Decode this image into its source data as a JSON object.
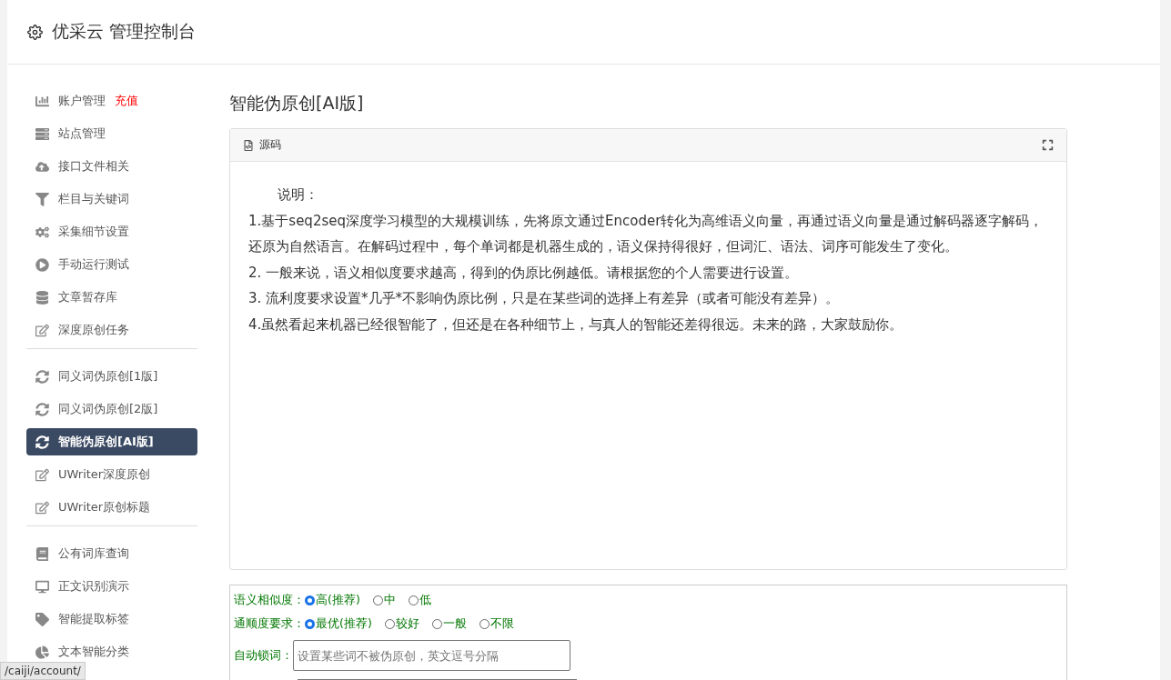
{
  "header": {
    "title": "优采云 管理控制台"
  },
  "sidebar": {
    "groups": [
      {
        "items": [
          {
            "label": "账户管理",
            "badge": "充值",
            "selected": false
          },
          {
            "label": "站点管理",
            "selected": false
          },
          {
            "label": "接口文件相关",
            "selected": false
          },
          {
            "label": "栏目与关键词",
            "selected": false
          },
          {
            "label": "采集细节设置",
            "selected": false
          },
          {
            "label": "手动运行测试",
            "selected": false
          },
          {
            "label": "文章暂存库",
            "selected": false
          },
          {
            "label": "深度原创任务",
            "selected": false
          }
        ]
      },
      {
        "items": [
          {
            "label": "同义词伪原创[1版]",
            "selected": false
          },
          {
            "label": "同义词伪原创[2版]",
            "selected": false
          },
          {
            "label": "智能伪原创[AI版]",
            "selected": true
          },
          {
            "label": "UWriter深度原创",
            "selected": false
          },
          {
            "label": "UWriter原创标题",
            "selected": false
          }
        ]
      },
      {
        "items": [
          {
            "label": "公有词库查询",
            "selected": false
          },
          {
            "label": "正文识别演示",
            "selected": false
          },
          {
            "label": "智能提取标签",
            "selected": false
          },
          {
            "label": "文本智能分类",
            "selected": false
          }
        ]
      }
    ]
  },
  "main": {
    "title": "智能伪原创[AI版]",
    "editor": {
      "toolbar_label": "源码",
      "paragraphs": [
        "说明：",
        "1.基于seq2seq深度学习模型的大规模训练，先将原文通过Encoder转化为高维语义向量，再通过语义向量是通过解码器逐字解码，还原为自然语言。在解码过程中，每个单词都是机器生成的，语义保持得很好，但词汇、语法、词序可能发生了变化。",
        "2. 一般来说，语义相似度要求越高，得到的伪原比例越低。请根据您的个人需要进行设置。",
        "3. 流利度要求设置*几乎*不影响伪原比例，只是在某些词的选择上有差异（或者可能没有差异）。",
        "4.虽然看起来机器已经很智能了，但还是在各种细节上，与真人的智能还差得很远。未来的路，大家鼓励你。"
      ]
    },
    "options": [
      {
        "label": "语义相似度：",
        "choices": [
          {
            "label": "高(推荐)",
            "selected": true
          },
          {
            "label": "中",
            "selected": false
          },
          {
            "label": "低",
            "selected": false
          }
        ]
      },
      {
        "label": "通顺度要求：",
        "choices": [
          {
            "label": "最优(推荐)",
            "selected": true
          },
          {
            "label": "较好",
            "selected": false
          },
          {
            "label": "一般",
            "selected": false
          },
          {
            "label": "不限",
            "selected": false
          }
        ]
      }
    ],
    "lock_words": {
      "label": "自动锁词：",
      "placeholder": "设置某些词不被伪原创，英文逗号分隔"
    }
  },
  "status_bar": {
    "url": "/caiji/account/"
  }
}
